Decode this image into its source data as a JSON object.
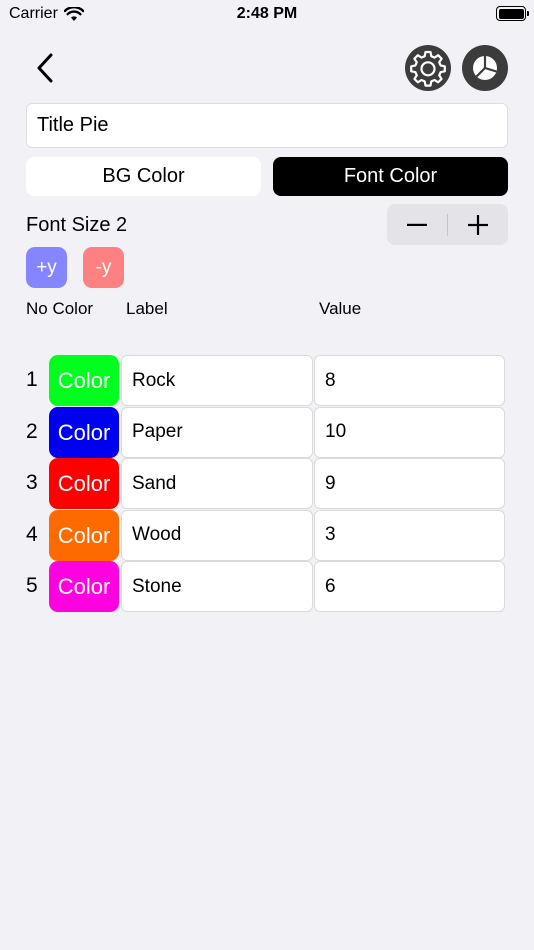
{
  "status_bar": {
    "carrier": "Carrier",
    "time": "2:48 PM"
  },
  "title_field": {
    "value": "Title Pie"
  },
  "color_toggle": {
    "bg_label": "BG Color",
    "font_label": "Font Color",
    "selected": "Font Color"
  },
  "font_size": {
    "label": "Font Size 2"
  },
  "y_buttons": {
    "plus": "+y",
    "minus": "-y"
  },
  "columns": {
    "no_color": "No Color",
    "label": "Label",
    "value": "Value"
  },
  "rows": [
    {
      "index": "1",
      "color_label": "Color",
      "color": "#00ff1e",
      "label": "Rock",
      "value": "8"
    },
    {
      "index": "2",
      "color_label": "Color",
      "color": "#0000f0",
      "label": "Paper",
      "value": "10"
    },
    {
      "index": "3",
      "color_label": "Color",
      "color": "#ff0000",
      "label": "Sand",
      "value": "9"
    },
    {
      "index": "4",
      "color_label": "Color",
      "color": "#ff6a00",
      "label": "Wood",
      "value": "3"
    },
    {
      "index": "5",
      "color_label": "Color",
      "color": "#ff00e0",
      "label": "Stone",
      "value": "6"
    }
  ],
  "colors": {
    "background": "#f2f1f6",
    "selected_toggle": "#000000",
    "plus_y": "#8585ff",
    "minus_y": "#ff8080",
    "round_button": "#3c3c3c"
  },
  "icons": {
    "back": "chevron-left-icon",
    "settings": "gear-icon",
    "chart": "pie-chart-icon",
    "wifi": "wifi-icon",
    "battery": "battery-icon",
    "minus": "minus-icon",
    "plus": "plus-icon"
  }
}
